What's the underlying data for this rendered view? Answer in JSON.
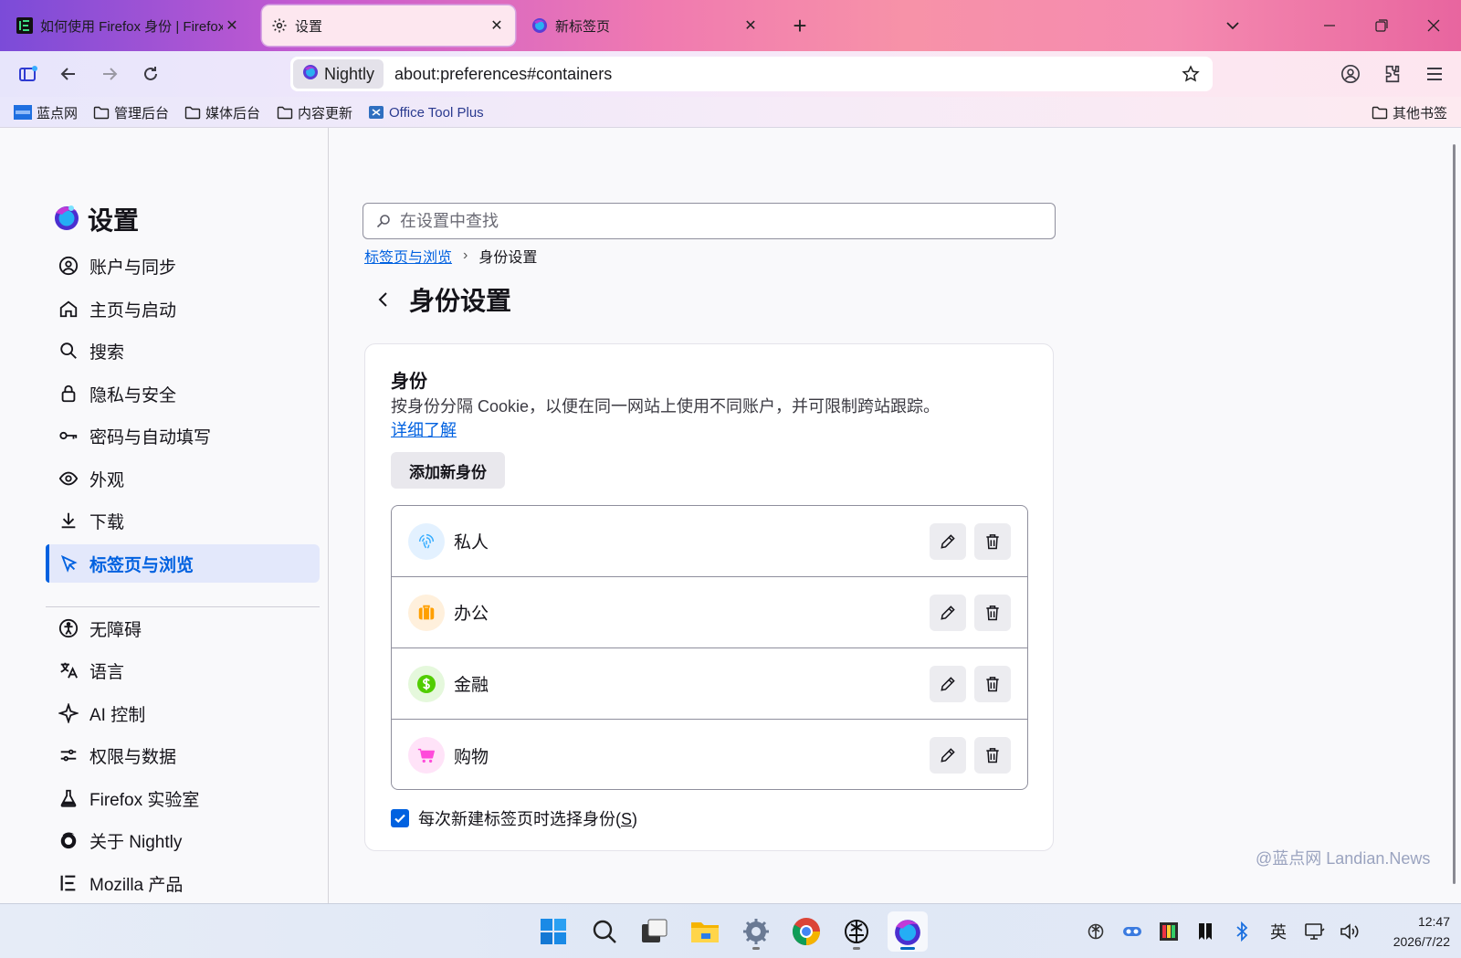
{
  "tabs": [
    {
      "label": "如何使用 Firefox 身份 | Firefox",
      "close": "✕"
    },
    {
      "label": "设置",
      "close": "✕"
    },
    {
      "label": "新标签页",
      "close": "✕"
    }
  ],
  "toolbar": {
    "new_tab": "+",
    "identity_label": "Nightly",
    "url": "about:preferences#containers"
  },
  "bookmarks": {
    "items": [
      "蓝点网",
      "管理后台",
      "媒体后台",
      "内容更新",
      "Office Tool Plus"
    ],
    "other": "其他书签"
  },
  "sidebar": {
    "title": "设置",
    "items": [
      {
        "label": "账户与同步",
        "icon": "account-icon"
      },
      {
        "label": "主页与启动",
        "icon": "home-icon"
      },
      {
        "label": "搜索",
        "icon": "search-icon"
      },
      {
        "label": "隐私与安全",
        "icon": "lock-icon"
      },
      {
        "label": "密码与自动填写",
        "icon": "key-icon"
      },
      {
        "label": "外观",
        "icon": "eye-icon"
      },
      {
        "label": "下载",
        "icon": "download-icon"
      },
      {
        "label": "标签页与浏览",
        "icon": "cursor-icon",
        "selected": true
      }
    ],
    "items2": [
      {
        "label": "无障碍",
        "icon": "accessibility-icon"
      },
      {
        "label": "语言",
        "icon": "translate-icon"
      },
      {
        "label": "AI 控制",
        "icon": "sparkle-icon"
      },
      {
        "label": "权限与数据",
        "icon": "sliders-icon"
      },
      {
        "label": "Firefox 实验室",
        "icon": "flask-icon"
      },
      {
        "label": "关于 Nightly",
        "icon": "nightly-icon"
      },
      {
        "label": "Mozilla 产品",
        "icon": "mozilla-icon"
      }
    ]
  },
  "main": {
    "search_placeholder": "在设置中查找",
    "breadcrumb_parent": "标签页与浏览",
    "breadcrumb_sep": "›",
    "breadcrumb_current": "身份设置",
    "page_title": "身份设置",
    "card_title": "身份",
    "card_desc": "按身份分隔 Cookie，以便在同一网站上使用不同账户，并可限制跨站跟踪。",
    "learn_more": "详细了解",
    "add_button": "添加新身份",
    "containers": [
      {
        "name": "私人",
        "icon": "fingerprint-icon",
        "color": "#37adff",
        "bg": "#e3f1ff"
      },
      {
        "name": "办公",
        "icon": "briefcase-icon",
        "color": "#ff9f00",
        "bg": "#fff0dc"
      },
      {
        "name": "金融",
        "icon": "dollar-icon",
        "color": "#51cd00",
        "bg": "#e5f8dc"
      },
      {
        "name": "购物",
        "icon": "cart-icon",
        "color": "#ff4bda",
        "bg": "#ffe3f8"
      }
    ],
    "checkbox_label": "每次新建标签页时选择身份(",
    "checkbox_key": "S",
    "checkbox_label_end": ")",
    "checkbox_checked": true
  },
  "watermark": "@蓝点网 Landian.News",
  "taskbar": {
    "ime": "英",
    "time": "12:47",
    "date": "2026/7/22"
  },
  "colors": {
    "accent": "#0061e0",
    "selected_bg": "#e3e8fb"
  }
}
